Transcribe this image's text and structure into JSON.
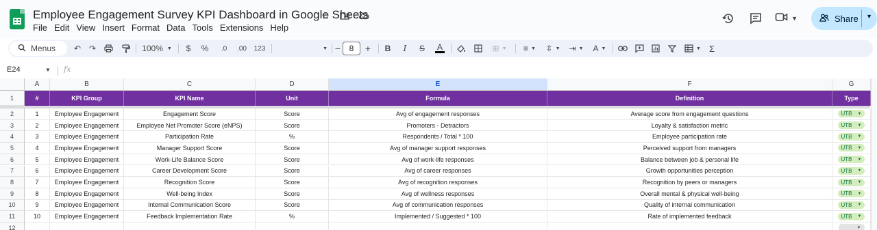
{
  "app": {
    "title": "Employee Engagement Survey KPI Dashboard in Google Sheets",
    "menu": [
      "File",
      "Edit",
      "View",
      "Insert",
      "Format",
      "Data",
      "Tools",
      "Extensions",
      "Help"
    ],
    "share_label": "Share"
  },
  "toolbar": {
    "search_label": "Menus",
    "zoom": "100%",
    "currency": "$",
    "percent": "%",
    "dec_decrease": ".0",
    "dec_increase": ".00",
    "number_format": "123",
    "font_size": "8",
    "bold": "B",
    "italic": "I",
    "strike": "S",
    "text_color": "A"
  },
  "formula_bar": {
    "name_box": "E24",
    "fx": "fx"
  },
  "columns": [
    "A",
    "B",
    "C",
    "D",
    "E",
    "F",
    "G"
  ],
  "selected_column": "E",
  "header_row": [
    "#",
    "KPI Group",
    "KPI Name",
    "Unit",
    "Formula",
    "Definition",
    "Type"
  ],
  "rows": [
    {
      "n": "1",
      "group": "Employee Engagement",
      "name": "Engagement Score",
      "unit": "Score",
      "formula": "Avg of engagement responses",
      "definition": "Average score from engagement questions",
      "type": "UTB"
    },
    {
      "n": "2",
      "group": "Employee Engagement",
      "name": "Employee Net Promoter Score (eNPS)",
      "unit": "Score",
      "formula": "Promoters - Detractors",
      "definition": "Loyalty & satisfaction metric",
      "type": "UTB"
    },
    {
      "n": "3",
      "group": "Employee Engagement",
      "name": "Participation Rate",
      "unit": "%",
      "formula": "Respondents / Total * 100",
      "definition": "Employee participation rate",
      "type": "UTB"
    },
    {
      "n": "4",
      "group": "Employee Engagement",
      "name": "Manager Support Score",
      "unit": "Score",
      "formula": "Avg of manager support responses",
      "definition": "Perceived support from managers",
      "type": "UTB"
    },
    {
      "n": "5",
      "group": "Employee Engagement",
      "name": "Work-Life Balance Score",
      "unit": "Score",
      "formula": "Avg of work-life responses",
      "definition": "Balance between job & personal life",
      "type": "UTB"
    },
    {
      "n": "6",
      "group": "Employee Engagement",
      "name": "Career Development Score",
      "unit": "Score",
      "formula": "Avg of career responses",
      "definition": "Growth opportunities perception",
      "type": "UTB"
    },
    {
      "n": "7",
      "group": "Employee Engagement",
      "name": "Recognition Score",
      "unit": "Score",
      "formula": "Avg of recognition responses",
      "definition": "Recognition by peers or managers",
      "type": "UTB"
    },
    {
      "n": "8",
      "group": "Employee Engagement",
      "name": "Well-being Index",
      "unit": "Score",
      "formula": "Avg of wellness responses",
      "definition": "Overall mental & physical well-being",
      "type": "UTB"
    },
    {
      "n": "9",
      "group": "Employee Engagement",
      "name": "Internal Communication Score",
      "unit": "Score",
      "formula": "Avg of communication responses",
      "definition": "Quality of internal communication",
      "type": "UTB"
    },
    {
      "n": "10",
      "group": "Employee Engagement",
      "name": "Feedback Implementation Rate",
      "unit": "%",
      "formula": "Implemented / Suggested * 100",
      "definition": "Rate of implemented feedback",
      "type": "UTB"
    }
  ],
  "row_numbers": [
    "1",
    "2",
    "3",
    "4",
    "5",
    "6",
    "7",
    "8",
    "9",
    "10",
    "11",
    "12"
  ],
  "colors": {
    "header_bg": "#7030a0",
    "chip_bg": "#d4edbc",
    "share_bg": "#c2e7ff",
    "accent": "#0b57d0"
  }
}
